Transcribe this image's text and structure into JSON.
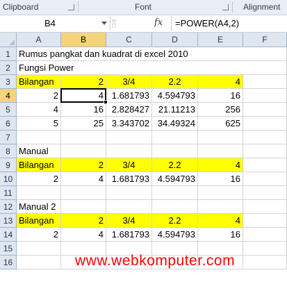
{
  "ribbon": {
    "groups": [
      "Clipboard",
      "Font",
      "Alignment"
    ]
  },
  "formula_bar": {
    "name_box": "B4",
    "fx_label": "fx",
    "formula": "=POWER(A4,2)"
  },
  "sheet": {
    "columns": [
      "A",
      "B",
      "C",
      "D",
      "E",
      "F"
    ],
    "selected_column": "B",
    "selected_row": "4",
    "rows": [
      {
        "num": "1",
        "cells": [
          {
            "col": "A",
            "text": "Rumus pangkat dan kuadrat di excel 2010",
            "align": "l",
            "overflow": true
          }
        ]
      },
      {
        "num": "2",
        "cells": [
          {
            "col": "A",
            "text": "Fungsi Power",
            "align": "l",
            "overflow": true
          }
        ]
      },
      {
        "num": "3",
        "highlight": true,
        "cells": [
          {
            "col": "A",
            "text": "Bilangan",
            "align": "l"
          },
          {
            "col": "B",
            "text": "2",
            "align": "r"
          },
          {
            "col": "C",
            "text": "3/4",
            "align": "c"
          },
          {
            "col": "D",
            "text": "2.2",
            "align": "c"
          },
          {
            "col": "E",
            "text": "4",
            "align": "r"
          }
        ]
      },
      {
        "num": "4",
        "cells": [
          {
            "col": "A",
            "text": "2",
            "align": "r"
          },
          {
            "col": "B",
            "text": "4",
            "align": "r"
          },
          {
            "col": "C",
            "text": "1.681793",
            "align": "r"
          },
          {
            "col": "D",
            "text": "4.594793",
            "align": "r"
          },
          {
            "col": "E",
            "text": "16",
            "align": "r"
          }
        ]
      },
      {
        "num": "5",
        "cells": [
          {
            "col": "A",
            "text": "4",
            "align": "r"
          },
          {
            "col": "B",
            "text": "16",
            "align": "r"
          },
          {
            "col": "C",
            "text": "2.828427",
            "align": "r"
          },
          {
            "col": "D",
            "text": "21.11213",
            "align": "r"
          },
          {
            "col": "E",
            "text": "256",
            "align": "r"
          }
        ]
      },
      {
        "num": "6",
        "cells": [
          {
            "col": "A",
            "text": "5",
            "align": "r"
          },
          {
            "col": "B",
            "text": "25",
            "align": "r"
          },
          {
            "col": "C",
            "text": "3.343702",
            "align": "r"
          },
          {
            "col": "D",
            "text": "34.49324",
            "align": "r"
          },
          {
            "col": "E",
            "text": "625",
            "align": "r"
          }
        ]
      },
      {
        "num": "7",
        "cells": []
      },
      {
        "num": "8",
        "cells": [
          {
            "col": "A",
            "text": "Manual",
            "align": "l"
          }
        ]
      },
      {
        "num": "9",
        "highlight": true,
        "cells": [
          {
            "col": "A",
            "text": "Bilangan",
            "align": "l"
          },
          {
            "col": "B",
            "text": "2",
            "align": "r"
          },
          {
            "col": "C",
            "text": "3/4",
            "align": "c"
          },
          {
            "col": "D",
            "text": "2.2",
            "align": "c"
          },
          {
            "col": "E",
            "text": "4",
            "align": "r"
          }
        ]
      },
      {
        "num": "10",
        "cells": [
          {
            "col": "A",
            "text": "2",
            "align": "r"
          },
          {
            "col": "B",
            "text": "4",
            "align": "r"
          },
          {
            "col": "C",
            "text": "1.681793",
            "align": "r"
          },
          {
            "col": "D",
            "text": "4.594793",
            "align": "r"
          },
          {
            "col": "E",
            "text": "16",
            "align": "r"
          }
        ]
      },
      {
        "num": "11",
        "cells": []
      },
      {
        "num": "12",
        "cells": [
          {
            "col": "A",
            "text": "Manual 2",
            "align": "l"
          }
        ]
      },
      {
        "num": "13",
        "highlight": true,
        "cells": [
          {
            "col": "A",
            "text": "Bilangan",
            "align": "l"
          },
          {
            "col": "B",
            "text": "2",
            "align": "r"
          },
          {
            "col": "C",
            "text": "3/4",
            "align": "c"
          },
          {
            "col": "D",
            "text": "2.2",
            "align": "c"
          },
          {
            "col": "E",
            "text": "4",
            "align": "r"
          }
        ]
      },
      {
        "num": "14",
        "cells": [
          {
            "col": "A",
            "text": "2",
            "align": "r"
          },
          {
            "col": "B",
            "text": "4",
            "align": "r"
          },
          {
            "col": "C",
            "text": "1.681793",
            "align": "r"
          },
          {
            "col": "D",
            "text": "4.594793",
            "align": "r"
          },
          {
            "col": "E",
            "text": "16",
            "align": "r"
          }
        ]
      },
      {
        "num": "15",
        "cells": []
      },
      {
        "num": "16",
        "cells": []
      }
    ]
  },
  "watermark": "www.webkomputer.com",
  "colors": {
    "highlight": "#ffff00",
    "header_bg": "#dfe6f0",
    "header_selected": "#f7d37a",
    "watermark": "#ff0000"
  }
}
